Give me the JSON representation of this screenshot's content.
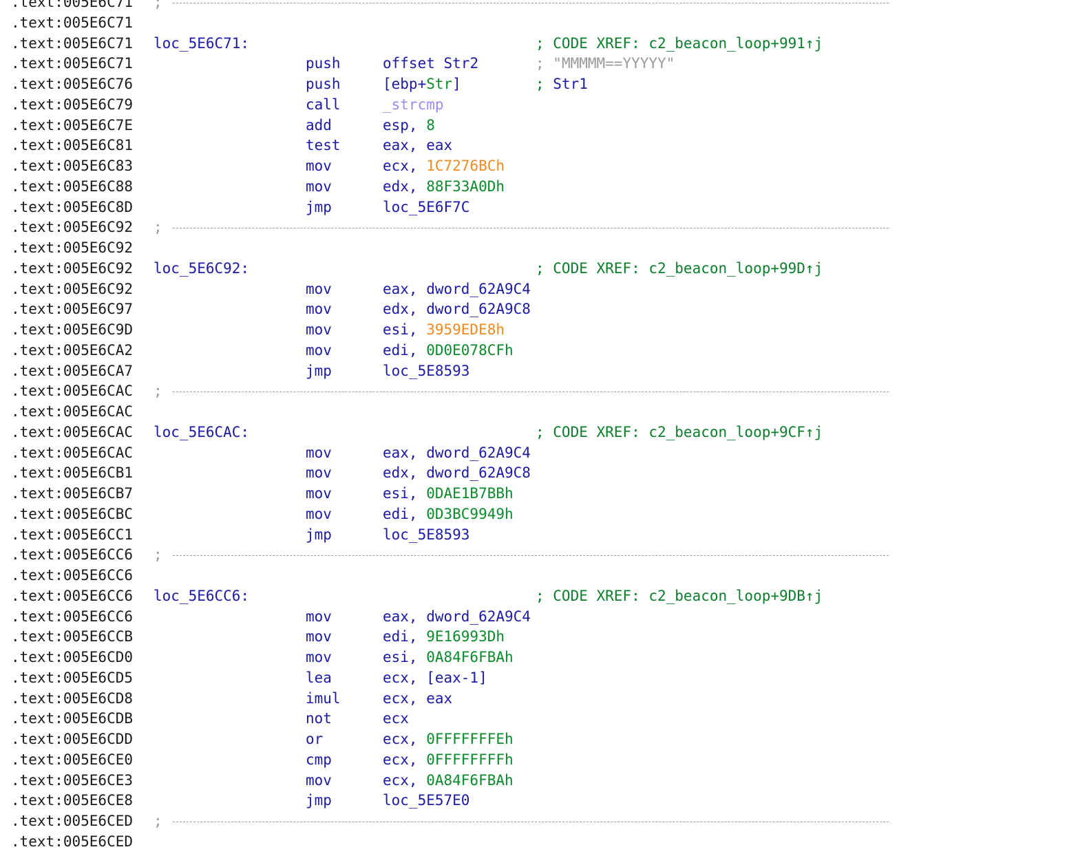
{
  "colors": {
    "background": "#ffffff",
    "address": "#1b1b1b",
    "code": "#1a1aa6",
    "comment": "#0a7e2a",
    "number": "#0a8a2a",
    "highlight_number": "#f08a1c",
    "external_symbol": "#9a8cf0",
    "separator": "#9a9a9a"
  },
  "listing": {
    "rows": [
      {
        "type": "separator",
        "addr": ".text:005E6C71",
        "semi": ";"
      },
      {
        "type": "blank",
        "addr": ".text:005E6C71"
      },
      {
        "type": "label",
        "addr": ".text:005E6C71",
        "label": "loc_5E6C71:",
        "comment": "; CODE XREF: c2_beacon_loop+991↑j"
      },
      {
        "type": "insn",
        "addr": ".text:005E6C71",
        "mnem": "push",
        "ops": [
          {
            "t": "offset "
          },
          {
            "t": "Str2"
          }
        ],
        "comment": ";",
        "comment_str": " \"MMMMM==YYYYY\""
      },
      {
        "type": "insn",
        "addr": ".text:005E6C76",
        "mnem": "push",
        "ops": [
          {
            "t": "[ebp+"
          },
          {
            "t": "Str",
            "c": "var"
          },
          {
            "t": "]"
          }
        ],
        "comment": ";",
        "comment_blue": " Str1"
      },
      {
        "type": "insn",
        "addr": ".text:005E6C79",
        "mnem": "call",
        "ops": [
          {
            "t": "_strcmp",
            "c": "ext"
          }
        ]
      },
      {
        "type": "insn",
        "addr": ".text:005E6C7E",
        "mnem": "add",
        "ops": [
          {
            "t": "esp, "
          },
          {
            "t": "8",
            "c": "num"
          }
        ]
      },
      {
        "type": "insn",
        "addr": ".text:005E6C81",
        "mnem": "test",
        "ops": [
          {
            "t": "eax, eax"
          }
        ]
      },
      {
        "type": "insn",
        "addr": ".text:005E6C83",
        "mnem": "mov",
        "ops": [
          {
            "t": "ecx, "
          },
          {
            "t": "1C7276BCh",
            "c": "hl"
          }
        ]
      },
      {
        "type": "insn",
        "addr": ".text:005E6C88",
        "mnem": "mov",
        "ops": [
          {
            "t": "edx, "
          },
          {
            "t": "88F33A0Dh",
            "c": "num"
          }
        ]
      },
      {
        "type": "insn",
        "addr": ".text:005E6C8D",
        "mnem": "jmp",
        "ops": [
          {
            "t": "loc_5E6F7C"
          }
        ]
      },
      {
        "type": "separator",
        "addr": ".text:005E6C92",
        "semi": ";"
      },
      {
        "type": "blank",
        "addr": ".text:005E6C92"
      },
      {
        "type": "label",
        "addr": ".text:005E6C92",
        "label": "loc_5E6C92:",
        "comment": "; CODE XREF: c2_beacon_loop+99D↑j"
      },
      {
        "type": "insn",
        "addr": ".text:005E6C92",
        "mnem": "mov",
        "ops": [
          {
            "t": "eax, dword_62A9C4"
          }
        ]
      },
      {
        "type": "insn",
        "addr": ".text:005E6C97",
        "mnem": "mov",
        "ops": [
          {
            "t": "edx, dword_62A9C8"
          }
        ]
      },
      {
        "type": "insn",
        "addr": ".text:005E6C9D",
        "mnem": "mov",
        "ops": [
          {
            "t": "esi, "
          },
          {
            "t": "3959EDE8h",
            "c": "hl"
          }
        ]
      },
      {
        "type": "insn",
        "addr": ".text:005E6CA2",
        "mnem": "mov",
        "ops": [
          {
            "t": "edi, "
          },
          {
            "t": "0D0E078CFh",
            "c": "num"
          }
        ]
      },
      {
        "type": "insn",
        "addr": ".text:005E6CA7",
        "mnem": "jmp",
        "ops": [
          {
            "t": "loc_5E8593"
          }
        ]
      },
      {
        "type": "separator",
        "addr": ".text:005E6CAC",
        "semi": ";"
      },
      {
        "type": "blank",
        "addr": ".text:005E6CAC"
      },
      {
        "type": "label",
        "addr": ".text:005E6CAC",
        "label": "loc_5E6CAC:",
        "comment": "; CODE XREF: c2_beacon_loop+9CF↑j"
      },
      {
        "type": "insn",
        "addr": ".text:005E6CAC",
        "mnem": "mov",
        "ops": [
          {
            "t": "eax, dword_62A9C4"
          }
        ]
      },
      {
        "type": "insn",
        "addr": ".text:005E6CB1",
        "mnem": "mov",
        "ops": [
          {
            "t": "edx, dword_62A9C8"
          }
        ]
      },
      {
        "type": "insn",
        "addr": ".text:005E6CB7",
        "mnem": "mov",
        "ops": [
          {
            "t": "esi, "
          },
          {
            "t": "0DAE1B7BBh",
            "c": "num"
          }
        ]
      },
      {
        "type": "insn",
        "addr": ".text:005E6CBC",
        "mnem": "mov",
        "ops": [
          {
            "t": "edi, "
          },
          {
            "t": "0D3BC9949h",
            "c": "num"
          }
        ]
      },
      {
        "type": "insn",
        "addr": ".text:005E6CC1",
        "mnem": "jmp",
        "ops": [
          {
            "t": "loc_5E8593"
          }
        ]
      },
      {
        "type": "separator",
        "addr": ".text:005E6CC6",
        "semi": ";"
      },
      {
        "type": "blank",
        "addr": ".text:005E6CC6"
      },
      {
        "type": "label",
        "addr": ".text:005E6CC6",
        "label": "loc_5E6CC6:",
        "comment": "; CODE XREF: c2_beacon_loop+9DB↑j"
      },
      {
        "type": "insn",
        "addr": ".text:005E6CC6",
        "mnem": "mov",
        "ops": [
          {
            "t": "eax, dword_62A9C4"
          }
        ]
      },
      {
        "type": "insn",
        "addr": ".text:005E6CCB",
        "mnem": "mov",
        "ops": [
          {
            "t": "edi, "
          },
          {
            "t": "9E16993Dh",
            "c": "num"
          }
        ]
      },
      {
        "type": "insn",
        "addr": ".text:005E6CD0",
        "mnem": "mov",
        "ops": [
          {
            "t": "esi, "
          },
          {
            "t": "0A84F6FBAh",
            "c": "num"
          }
        ]
      },
      {
        "type": "insn",
        "addr": ".text:005E6CD5",
        "mnem": "lea",
        "ops": [
          {
            "t": "ecx, [eax-1]"
          }
        ]
      },
      {
        "type": "insn",
        "addr": ".text:005E6CD8",
        "mnem": "imul",
        "ops": [
          {
            "t": "ecx, eax"
          }
        ]
      },
      {
        "type": "insn",
        "addr": ".text:005E6CDB",
        "mnem": "not",
        "ops": [
          {
            "t": "ecx"
          }
        ]
      },
      {
        "type": "insn",
        "addr": ".text:005E6CDD",
        "mnem": "or",
        "ops": [
          {
            "t": "ecx, "
          },
          {
            "t": "0FFFFFFFEh",
            "c": "num"
          }
        ]
      },
      {
        "type": "insn",
        "addr": ".text:005E6CE0",
        "mnem": "cmp",
        "ops": [
          {
            "t": "ecx, "
          },
          {
            "t": "0FFFFFFFFh",
            "c": "num"
          }
        ]
      },
      {
        "type": "insn",
        "addr": ".text:005E6CE3",
        "mnem": "mov",
        "ops": [
          {
            "t": "ecx, "
          },
          {
            "t": "0A84F6FBAh",
            "c": "num"
          }
        ]
      },
      {
        "type": "insn",
        "addr": ".text:005E6CE8",
        "mnem": "jmp",
        "ops": [
          {
            "t": "loc_5E57E0"
          }
        ]
      },
      {
        "type": "separator",
        "addr": ".text:005E6CED",
        "semi": ";"
      },
      {
        "type": "blank",
        "addr": ".text:005E6CED"
      }
    ]
  }
}
